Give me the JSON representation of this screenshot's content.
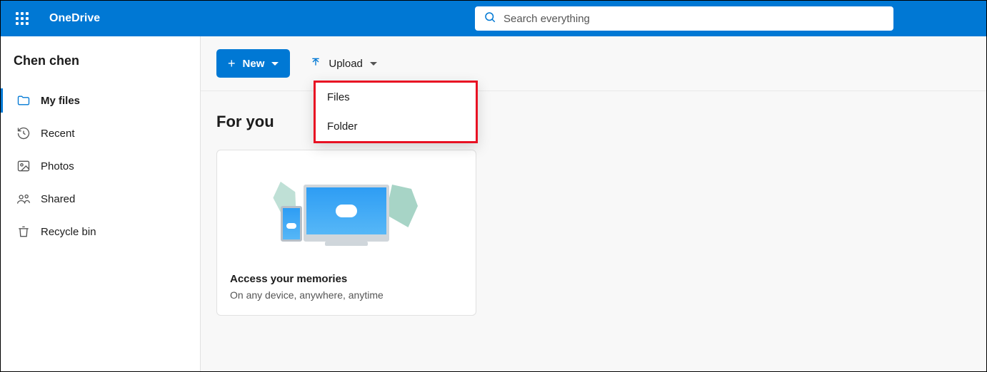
{
  "header": {
    "brand": "OneDrive",
    "search_placeholder": "Search everything"
  },
  "sidebar": {
    "user": "Chen chen",
    "items": [
      {
        "label": "My files",
        "icon": "folder-icon",
        "active": true
      },
      {
        "label": "Recent",
        "icon": "recent-icon",
        "active": false
      },
      {
        "label": "Photos",
        "icon": "photos-icon",
        "active": false
      },
      {
        "label": "Shared",
        "icon": "shared-icon",
        "active": false
      },
      {
        "label": "Recycle bin",
        "icon": "trash-icon",
        "active": false
      }
    ]
  },
  "toolbar": {
    "new_label": "New",
    "upload_label": "Upload",
    "upload_menu": [
      {
        "label": "Files"
      },
      {
        "label": "Folder"
      }
    ]
  },
  "section": {
    "title": "For you",
    "cards": [
      {
        "title": "Access your memories",
        "subtitle": "On any device, anywhere, anytime"
      }
    ]
  },
  "colors": {
    "primary": "#0078d4",
    "highlight_box": "#e81123"
  }
}
